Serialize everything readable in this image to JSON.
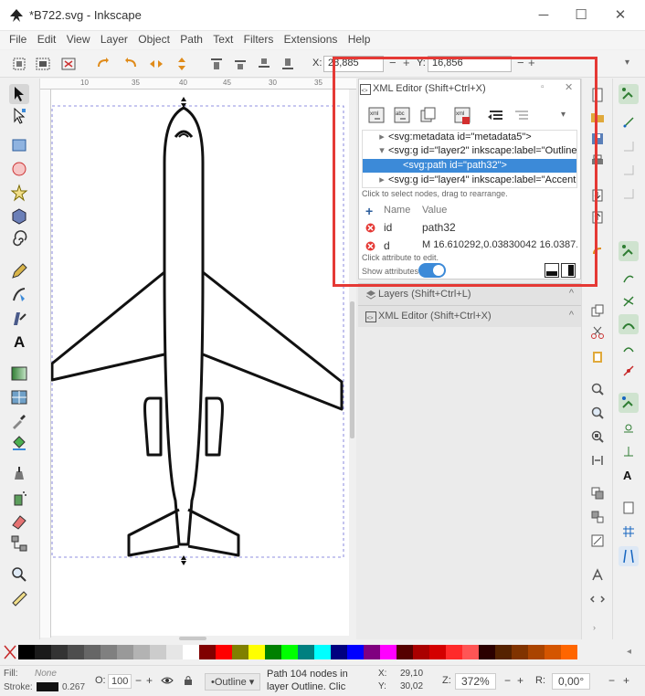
{
  "window": {
    "title": "*B722.svg - Inkscape",
    "minimize": "─",
    "maximize": "☐",
    "close": "✕"
  },
  "menu": [
    "File",
    "Edit",
    "View",
    "Layer",
    "Object",
    "Path",
    "Text",
    "Filters",
    "Extensions",
    "Help"
  ],
  "toolbar": {
    "x_label": "X:",
    "x_value": "28,885",
    "y_label": "Y:",
    "y_value": "16,856",
    "minus": "−",
    "plus": "+"
  },
  "ruler": {
    "ticks": [
      "10",
      "35",
      "40",
      "45",
      "30",
      "35"
    ]
  },
  "xml_editor": {
    "title": "XML Editor (Shift+Ctrl+X)",
    "nodes": [
      {
        "text": "<svg:metadata id=\"metadata5\">",
        "expander": "▸"
      },
      {
        "text": "<svg:g id=\"layer2\" inkscape:label=\"Outline",
        "expander": "▾"
      },
      {
        "text": "<svg:path id=\"path32\">",
        "expander": ""
      },
      {
        "text": "<svg:g id=\"layer4\" inkscape:label=\"Accent",
        "expander": "▸"
      }
    ],
    "tree_hint": "Click to select nodes, drag to rearrange.",
    "attr_header_name": "Name",
    "attr_header_value": "Value",
    "attributes": [
      {
        "name": "id",
        "value": "path32"
      },
      {
        "name": "d",
        "value": "M 16.610292,0.03830042 16.0387..."
      }
    ],
    "attr_hint": "Click attribute to edit.",
    "show_attributes": "Show attributes"
  },
  "dock_tabs": [
    {
      "label": "Layers (Shift+Ctrl+L)",
      "chevron": "^"
    },
    {
      "label": "XML Editor (Shift+Ctrl+X)",
      "chevron": "^"
    }
  ],
  "status": {
    "fill_label": "Fill:",
    "fill_value": "None",
    "stroke_label": "Stroke:",
    "stroke_width": "0.267",
    "opacity_label": "O:",
    "opacity_value": "100",
    "layer": "•Outline",
    "message_line1": "Path 104 nodes in",
    "message_line2": "layer Outline. Clic",
    "x_label": "X:",
    "x_value": "29,10",
    "y_label": "Y:",
    "y_value": "30,02",
    "zoom_label": "Z:",
    "zoom_value": "372%",
    "rotate_label": "R:",
    "rotate_value": "0,00°"
  },
  "palette_colors": [
    "#000000",
    "#1a1a1a",
    "#333333",
    "#4d4d4d",
    "#666666",
    "#808080",
    "#999999",
    "#b3b3b3",
    "#cccccc",
    "#e6e6e6",
    "#ffffff",
    "#800000",
    "#ff0000",
    "#808000",
    "#ffff00",
    "#008000",
    "#00ff00",
    "#008080",
    "#00ffff",
    "#000080",
    "#0000ff",
    "#800080",
    "#ff00ff",
    "#550000",
    "#aa0000",
    "#d40000",
    "#ff2a2a",
    "#ff5555",
    "#2b0000",
    "#552200",
    "#803300",
    "#aa4400",
    "#d45500",
    "#ff6600"
  ],
  "colors": {
    "selection": "#3c8ad8",
    "highlight": "#e53935",
    "accent_green": "#4caf50",
    "toggle": "#3c8ad8"
  }
}
